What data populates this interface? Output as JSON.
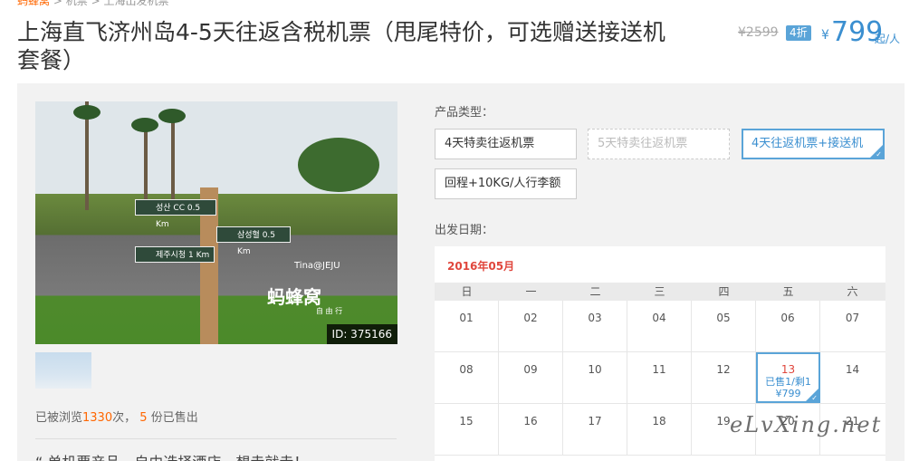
{
  "breadcrumb": {
    "items": [
      "蚂蜂窝",
      "机票",
      "上海出发机票"
    ]
  },
  "product": {
    "title": "上海直飞济州岛4-5天往返含税机票（甩尾特价，可选赠送接送机套餐）",
    "old_price": "¥2599",
    "discount": "4折",
    "currency": "¥",
    "price": "799",
    "price_unit": "起/人"
  },
  "gallery": {
    "image_id": "ID: 375166",
    "watermark_small": "Tina@JEJU",
    "watermark_brand": "蚂蜂窝",
    "watermark_sub": "自 由 行",
    "signs": [
      "성산 CC 0.5 Km",
      "삼성혈 0.5 Km",
      "제주시청 1 Km"
    ]
  },
  "stats": {
    "prefix": "已被浏览",
    "views": "1330",
    "middle": "次，",
    "sold": "5",
    "suffix": "份已售出"
  },
  "description": "“ 单机票产品，自由选择酒店，想走就走！",
  "options": {
    "label": "产品类型：",
    "items": [
      {
        "label": "4天特卖往返机票",
        "state": "normal"
      },
      {
        "label": "5天特卖往返机票",
        "state": "disabled"
      },
      {
        "label": "4天往返机票+接送机",
        "state": "selected"
      },
      {
        "label": "回程+10KG/人行李额",
        "state": "normal"
      }
    ]
  },
  "departure": {
    "label": "出发日期：",
    "month": "2016年05月",
    "weekdays": [
      "日",
      "一",
      "二",
      "三",
      "四",
      "五",
      "六"
    ],
    "weeks": [
      [
        "01",
        "02",
        "03",
        "04",
        "05",
        "06",
        "07"
      ],
      [
        "08",
        "09",
        "10",
        "11",
        "12",
        "13",
        "14"
      ],
      [
        "15",
        "16",
        "17",
        "18",
        "19",
        "20",
        "21"
      ]
    ],
    "selected_day": {
      "day": "13",
      "status": "已售1/剩1",
      "price": "¥799"
    }
  },
  "site_watermark": "eLvXing.net",
  "colors": {
    "accent": "#5aa4d8",
    "price": "#3b8fd0",
    "highlight": "#ff6600",
    "month": "#e0463c"
  }
}
